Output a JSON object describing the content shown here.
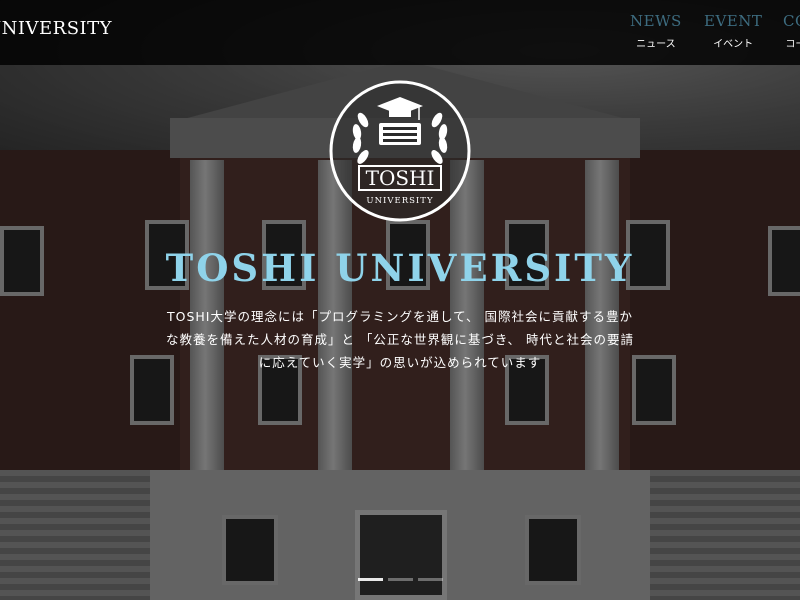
{
  "header": {
    "brand": "UNIVERSITY",
    "nav": [
      {
        "en": "NEWS",
        "ja": "ニュース"
      },
      {
        "en": "EVENT",
        "ja": "イベント"
      },
      {
        "en": "CO",
        "ja": "コー"
      }
    ]
  },
  "emblem": {
    "name": "TOSHI",
    "sub": "UNIVERSITY"
  },
  "hero": {
    "title": "TOSHI UNIVERSITY",
    "lines": [
      "TOSHI大学の理念には「プログラミングを通して、 国際社会に貢献する豊か",
      "な教養を備えた人材の育成」と 「公正な世界観に基づき、 時代と社会の要請",
      "に応えていく実学」の思いが込められています"
    ]
  },
  "slider": {
    "count": 3,
    "active_index": 0
  },
  "colors": {
    "accent": "#8fd3ea",
    "nav_en": "#3d6c80",
    "topbar": "#000000"
  }
}
